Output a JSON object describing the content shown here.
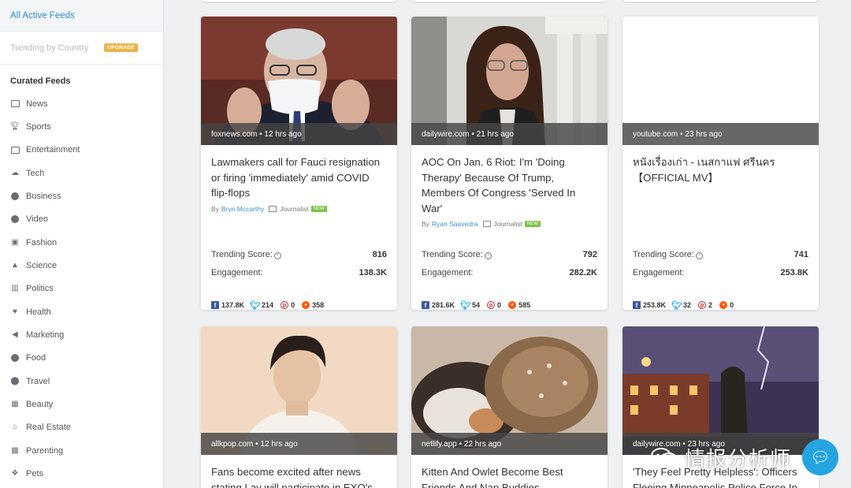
{
  "sidebar": {
    "active_feed": "All Active Feeds",
    "trending": "Trending by Country",
    "trending_badge": "UPGRADE",
    "curated_heading": "Curated Feeds",
    "items": [
      {
        "label": "News",
        "icon": "newspaper-icon"
      },
      {
        "label": "Sports",
        "icon": "trophy-icon"
      },
      {
        "label": "Entertainment",
        "icon": "monitor-icon"
      },
      {
        "label": "Tech",
        "icon": "cloud-icon"
      },
      {
        "label": "Business",
        "icon": "dollar-icon"
      },
      {
        "label": "Video",
        "icon": "play-icon"
      },
      {
        "label": "Fashion",
        "icon": "shopping-bag-icon"
      },
      {
        "label": "Science",
        "icon": "flask-icon"
      },
      {
        "label": "Politics",
        "icon": "institution-icon"
      },
      {
        "label": "Health",
        "icon": "heart-icon"
      },
      {
        "label": "Marketing",
        "icon": "megaphone-icon"
      },
      {
        "label": "Food",
        "icon": "apple-icon"
      },
      {
        "label": "Travel",
        "icon": "map-pin-icon"
      },
      {
        "label": "Beauty",
        "icon": "beauty-icon"
      },
      {
        "label": "Real Estate",
        "icon": "home-icon"
      },
      {
        "label": "Parenting",
        "icon": "family-icon"
      },
      {
        "label": "Pets",
        "icon": "paw-icon"
      }
    ]
  },
  "labels": {
    "trending_score": "Trending Score:",
    "engagement": "Engagement:",
    "by": "By",
    "journalist": "Journalist",
    "new": "NEW"
  },
  "cards": [
    {
      "source": "foxnews.com • 12 hrs ago",
      "title": "Lawmakers call for Fauci resignation or firing 'immediately' amid COVID flip-flops",
      "author": "Bryn Mccarthy",
      "trending_score": "816",
      "engagement": "138.3K",
      "facebook": "137.8K",
      "twitter": "214",
      "pinterest": "0",
      "reddit": "358"
    },
    {
      "source": "dailywire.com • 21 hrs ago",
      "title": "AOC On Jan. 6 Riot: I'm 'Doing Therapy' Because Of Trump, Members Of Congress 'Served In War'",
      "author": "Ryan Saavedra",
      "trending_score": "792",
      "engagement": "282.2K",
      "facebook": "281.6K",
      "twitter": "54",
      "pinterest": "0",
      "reddit": "585"
    },
    {
      "source": "youtube.com • 23 hrs ago",
      "title": "หนังเรื่องเก่า - เนสกาแฟ ศรีนคร 【OFFICIAL MV】",
      "trending_score": "741",
      "engagement": "253.8K",
      "facebook": "253.8K",
      "twitter": "32",
      "pinterest": "2",
      "reddit": "0"
    },
    {
      "source": "allkpop.com • 12 hrs ago",
      "title": "Fans become excited after news stating Lay will participate in EXO's"
    },
    {
      "source": "netlify.app • 22 hrs ago",
      "title": "Kitten And Owlet Become Best Friends And Nap Buddies"
    },
    {
      "source": "dailywire.com • 23 hrs ago",
      "title": "'They Feel Pretty Helpless': Officers Fleeing Minneapolis Police Force In"
    }
  ],
  "watermark": "情报分析师",
  "colors": {
    "accent": "#2f8fd3",
    "badge": "#e9b54a",
    "new_badge": "#7cc24a"
  }
}
